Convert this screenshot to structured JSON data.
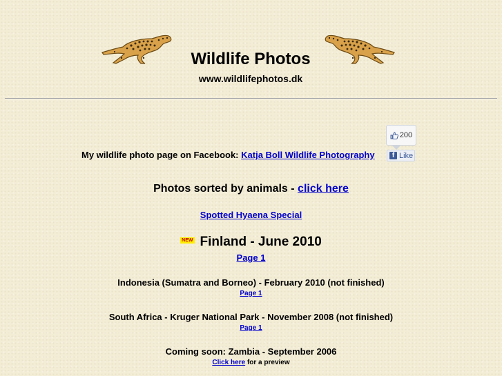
{
  "header": {
    "title": "Wildlife Photos",
    "url": "www.wildlifephotos.dk"
  },
  "facebook": {
    "text": "My wildlife photo page on Facebook:",
    "link": "Katja Boll Wildlife Photography",
    "like_count": "200",
    "like_label": "Like"
  },
  "animals": {
    "text": "Photos sorted by animals -",
    "link": "click here"
  },
  "special": {
    "link": "Spotted Hyaena Special"
  },
  "featured": {
    "badge": "NEW",
    "title": "Finland - June 2010",
    "page_link": "Page 1"
  },
  "trips": [
    {
      "title": "Indonesia (Sumatra and Borneo) - February 2010 (not finished)",
      "page_link": "Page 1"
    },
    {
      "title": "South Africa - Kruger National Park - November 2008 (not finished)",
      "page_link": "Page 1"
    }
  ],
  "coming_soon": {
    "title": "Coming soon: Zambia - September 2006",
    "link": "Click here",
    "suffix": "for a preview"
  },
  "icons": {
    "cheetah_left": "cheetah-icon",
    "cheetah_right": "cheetah-icon",
    "thumbs_up": "thumbs-up-icon",
    "facebook": "facebook-icon"
  },
  "colors": {
    "background": "#f3edd6",
    "link": "#0000cc",
    "new_badge": "#ffee00"
  }
}
